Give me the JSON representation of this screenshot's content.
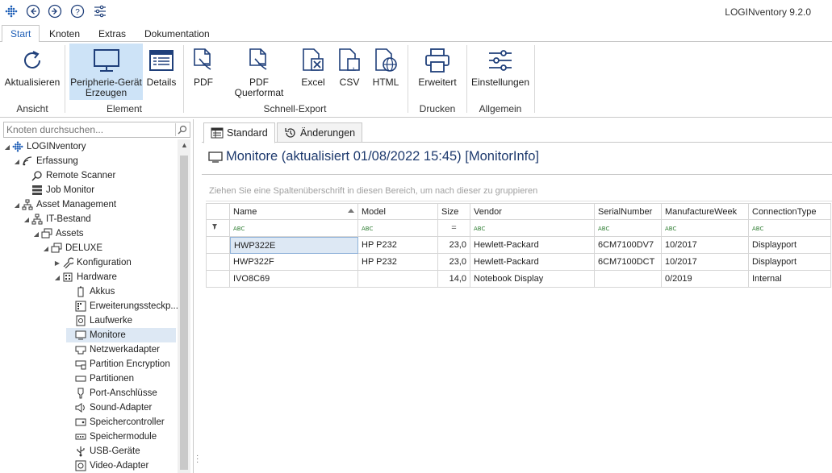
{
  "app": {
    "title": "LOGINventory 9.2.0"
  },
  "ribbon_tabs": [
    "Start",
    "Knoten",
    "Extras",
    "Dokumentation"
  ],
  "ribbon": {
    "buttons": {
      "aktualisieren": "Aktualisieren",
      "peripherie_line1": "Peripherie-Gerät",
      "peripherie_line2": "Erzeugen",
      "details": "Details",
      "pdf": "PDF",
      "pdf_quer": "PDF Querformat",
      "excel": "Excel",
      "csv": "CSV",
      "html": "HTML",
      "erweitert": "Erweitert",
      "einstellungen": "Einstellungen"
    },
    "groups": {
      "ansicht": "Ansicht",
      "element": "Element",
      "schnell_export": "Schnell-Export",
      "drucken": "Drucken",
      "allgemein": "Allgemein"
    }
  },
  "search": {
    "placeholder": "Knoten durchsuchen..."
  },
  "tree": {
    "items": [
      {
        "label": "LOGINventory"
      },
      {
        "label": "Erfassung"
      },
      {
        "label": "Remote Scanner"
      },
      {
        "label": "Job Monitor"
      },
      {
        "label": "Asset Management"
      },
      {
        "label": "IT-Bestand"
      },
      {
        "label": "Assets"
      },
      {
        "label": "DELUXE"
      },
      {
        "label": "Konfiguration"
      },
      {
        "label": "Hardware"
      },
      {
        "label": "Akkus"
      },
      {
        "label": "Erweiterungssteckp..."
      },
      {
        "label": "Laufwerke"
      },
      {
        "label": "Monitore"
      },
      {
        "label": "Netzwerkadapter"
      },
      {
        "label": "Partition Encryption"
      },
      {
        "label": "Partitionen"
      },
      {
        "label": "Port-Anschlüsse"
      },
      {
        "label": "Sound-Adapter"
      },
      {
        "label": "Speichercontroller"
      },
      {
        "label": "Speichermodule"
      },
      {
        "label": "USB-Geräte"
      },
      {
        "label": "Video-Adapter"
      }
    ]
  },
  "content": {
    "tabs": [
      "Standard",
      "Änderungen"
    ],
    "title": "Monitore (aktualisiert 01/08/2022 15:45) [MonitorInfo]",
    "groupby_hint": "Ziehen Sie eine Spaltenüberschrift in diesen Bereich, um nach dieser zu gruppieren",
    "columns": [
      "Name",
      "Model",
      "Size",
      "Vendor",
      "SerialNumber",
      "ManufactureWeek",
      "ConnectionType"
    ],
    "filter_abc": "ABC",
    "filter_eq": "=",
    "rows": [
      [
        "HWP322E",
        "HP P232",
        "23,0",
        "Hewlett-Packard",
        "6CM7100DV7",
        "10/2017",
        "Displayport"
      ],
      [
        "HWP322F",
        "HP P232",
        "23,0",
        "Hewlett-Packard",
        "6CM7100DCT",
        "10/2017",
        "Displayport"
      ],
      [
        "IVO8C69",
        "",
        "14,0",
        "Notebook Display",
        "",
        "0/2019",
        "Internal"
      ]
    ]
  }
}
